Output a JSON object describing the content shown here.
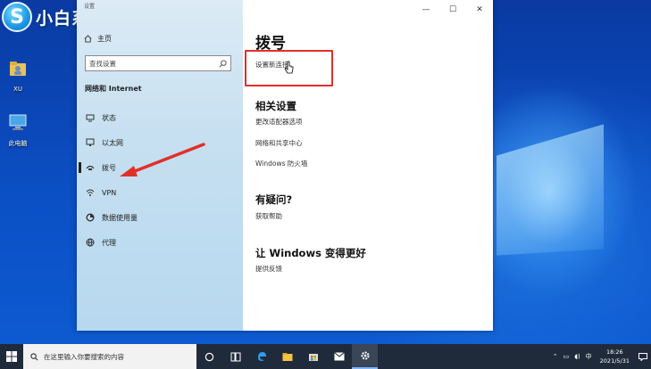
{
  "brand": {
    "logo_letter": "S",
    "text": "小白系统"
  },
  "desktop": {
    "icons": [
      {
        "label": "XU",
        "icon": "user-folder-icon"
      },
      {
        "label": "此电脑",
        "icon": "computer-icon"
      }
    ]
  },
  "window": {
    "controls": [
      "—",
      "☐",
      "✕"
    ],
    "nav": {
      "back_label": "设置",
      "home_label": "主页",
      "search_placeholder": "查找设置",
      "section_title": "网络和 Internet",
      "items": [
        {
          "label": "状态",
          "icon": "status-icon"
        },
        {
          "label": "以太网",
          "icon": "ethernet-icon"
        },
        {
          "label": "拨号",
          "icon": "dialup-icon",
          "selected": true
        },
        {
          "label": "VPN",
          "icon": "vpn-icon"
        },
        {
          "label": "数据使用量",
          "icon": "data-usage-icon"
        },
        {
          "label": "代理",
          "icon": "proxy-icon"
        }
      ]
    },
    "content": {
      "title": "拨号",
      "setup_link": "设置新连接",
      "related_heading": "相关设置",
      "related_links": [
        "更改适配器选项",
        "网络和共享中心",
        "Windows 防火墙"
      ],
      "help_heading": "有疑问?",
      "help_link": "获取帮助",
      "feedback_heading": "让 Windows 变得更好",
      "feedback_link": "提供反馈"
    }
  },
  "taskbar": {
    "search_placeholder": "在这里输入你要搜索的内容",
    "apps": [
      "cortana-icon",
      "task-view-icon",
      "edge-icon",
      "file-explorer-icon",
      "store-icon",
      "mail-icon",
      "settings-icon"
    ],
    "tray": {
      "ime": "中",
      "time": "18:26",
      "date": "2021/5/31"
    }
  },
  "colors": {
    "accent": "#0078d7",
    "highlight": "#e0302a",
    "taskbar": "#1f2b3a"
  }
}
